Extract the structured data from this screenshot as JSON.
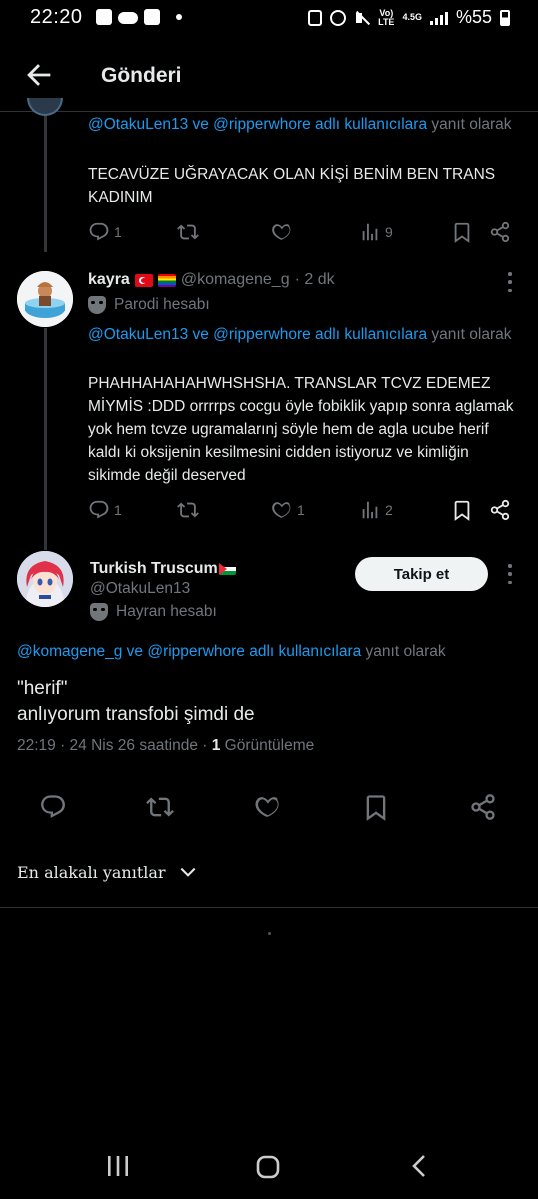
{
  "status_bar": {
    "time": "22:20",
    "network": "4.5G",
    "battery": "%55",
    "left_icons": [
      "box-icon",
      "cloud-icon",
      "box-icon",
      "dot"
    ],
    "right_icons": [
      "clipboard-icon",
      "alarm-icon",
      "mute-icon",
      "volte-icon",
      "signal-icon",
      "battery-icon"
    ]
  },
  "header": {
    "title": "Gönderi"
  },
  "tweet1": {
    "reply_to_links": "@OtakuLen13 ve @ripperwhore adlı kullanıcılara",
    "reply_to_suffix": "yanıt olarak",
    "text": "TECAVÜZE UĞRAYACAK OLAN KİŞİ BENİM BEN TRANS KADINIM",
    "replies": "1",
    "views": "9"
  },
  "tweet2": {
    "name": "kayra",
    "flags": [
      "turkey-flag-icon",
      "rainbow-flag-icon"
    ],
    "handle": "@komagene_g",
    "time": "· 2 dk",
    "label": "Parodi hesabı",
    "reply_to_links": "@OtakuLen13 ve @ripperwhore adlı kullanıcılara",
    "reply_to_suffix": "yanıt olarak",
    "text": "PHAHHAHAHAHWHSHSHA. TRANSLAR TCVZ EDEMEZ MİYMİS :DDD orrrrps cocgu öyle fobiklik yapıp sonra aglamak yok hem tcvze ugramalarınj söyle hem de agla ucube herif kaldı ki oksijenin kesilmesini cidden istiyoruz ve kimliğin sikimde değil deserved",
    "replies": "1",
    "likes": "1",
    "views": "2"
  },
  "main_tweet": {
    "name": "Turkish Truscum",
    "flag": "palestine-flag-icon",
    "handle": "@OtakuLen13",
    "label": "Hayran hesabı",
    "follow_label": "Takip et",
    "reply_to_links": "@komagene_g ve @ripperwhore adlı kullanıcılara",
    "reply_to_suffix": "yanıt olarak",
    "text_line1": "\"herif\"",
    "text_line2": "anlıyorum transfobi şimdi de",
    "meta_time": "22:19 · 24 Nis 26 saatinde ·",
    "meta_views_count": "1",
    "meta_views_label": "Görüntüleme"
  },
  "sort": {
    "label": "En alakalı yanıtlar"
  },
  "colors": {
    "background": "#000000",
    "link": "#1d9bf0",
    "muted": "#71767b",
    "text": "#e7e9ea",
    "follow_button_bg": "#eff3f4"
  }
}
